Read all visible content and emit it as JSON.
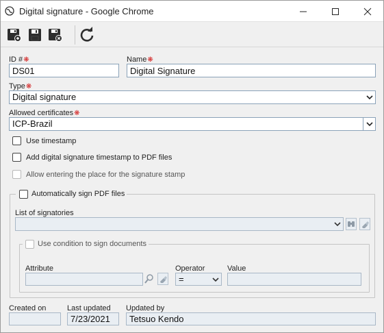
{
  "window": {
    "title": "Digital signature - Google Chrome"
  },
  "toolbar": {
    "buttons": [
      {
        "name": "save-new-icon"
      },
      {
        "name": "save-icon"
      },
      {
        "name": "save-close-icon"
      },
      {
        "name": "refresh-icon"
      }
    ]
  },
  "form": {
    "id_label": "ID #",
    "id_value": "DS01",
    "name_label": "Name",
    "name_value": "Digital Signature",
    "type_label": "Type",
    "type_value": "Digital signature",
    "certs_label": "Allowed certificates",
    "certs_value": "ICP-Brazil",
    "use_timestamp": "Use timestamp",
    "add_timestamp_pdf": "Add digital signature timestamp to PDF files",
    "allow_place": "Allow entering the place for the signature stamp",
    "auto_sign": "Automatically sign PDF files",
    "signatories_label": "List of signatories",
    "signatories_value": "",
    "use_condition": "Use condition to sign documents",
    "attribute_label": "Attribute",
    "attribute_value": "",
    "operator_label": "Operator",
    "operator_value": "=",
    "value_label": "Value",
    "value_value": "",
    "created_label": "Created on",
    "created_value": "",
    "updated_label": "Last updated",
    "updated_value": "7/23/2021",
    "updated_by_label": "Updated by",
    "updated_by_value": "Tetsuo Kendo"
  },
  "colors": {
    "required": "#d21f1f",
    "input_border": "#8aa2b8",
    "disabled_bg": "#e9eef3"
  }
}
